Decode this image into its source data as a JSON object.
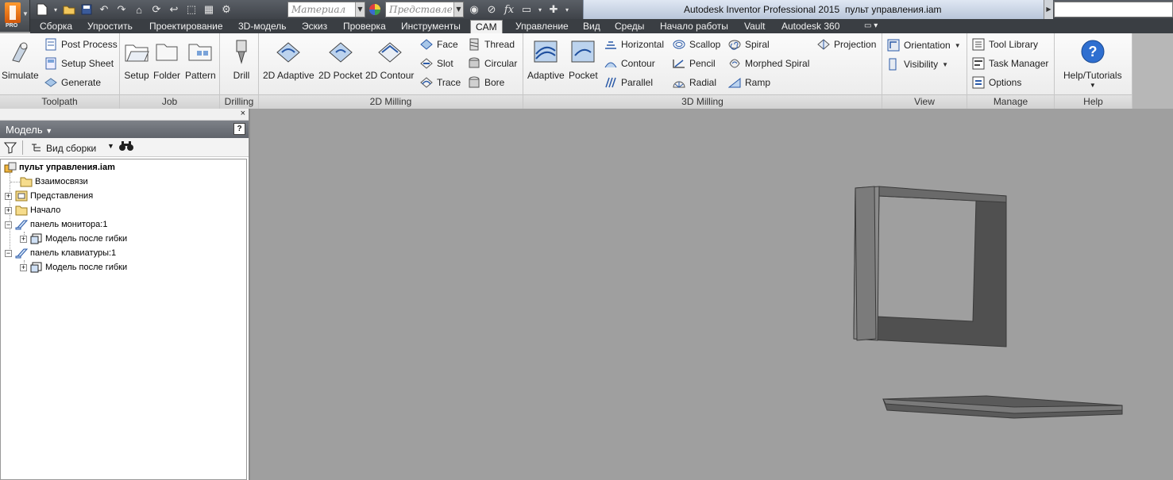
{
  "title_bar": {
    "app_name": "Autodesk Inventor Professional 2015",
    "document": "пульт управления.iam",
    "app_badge": "PRO",
    "material_placeholder": "Материал",
    "appearance_placeholder": "Представлен",
    "fx": "fx"
  },
  "menu_tabs": [
    "Сборка",
    "Упростить",
    "Проектирование",
    "3D-модель",
    "Эскиз",
    "Проверка",
    "Инструменты",
    "CAM",
    "Управление",
    "Вид",
    "Среды",
    "Начало работы",
    "Vault",
    "Autodesk 360"
  ],
  "active_tab": "CAM",
  "ribbon": {
    "toolpath": {
      "label": "Toolpath",
      "simulate": "Simulate",
      "post_process": "Post Process",
      "setup_sheet": "Setup Sheet",
      "generate": "Generate"
    },
    "job": {
      "label": "Job",
      "setup": "Setup",
      "folder": "Folder",
      "pattern": "Pattern"
    },
    "drilling": {
      "label": "Drilling",
      "drill": "Drill"
    },
    "milling2d": {
      "label": "2D Milling",
      "adaptive": "2D Adaptive",
      "pocket": "2D Pocket",
      "contour": "2D Contour",
      "face": "Face",
      "slot": "Slot",
      "trace": "Trace",
      "thread": "Thread",
      "circular": "Circular",
      "bore": "Bore"
    },
    "milling3d": {
      "label": "3D Milling",
      "adaptive": "Adaptive",
      "pocket": "Pocket",
      "horizontal": "Horizontal",
      "contour": "Contour",
      "parallel": "Parallel",
      "scallop": "Scallop",
      "pencil": "Pencil",
      "radial": "Radial",
      "spiral": "Spiral",
      "morphed_spiral": "Morphed Spiral",
      "ramp": "Ramp",
      "projection": "Projection"
    },
    "view": {
      "label": "View",
      "orientation": "Orientation",
      "visibility": "Visibility"
    },
    "manage": {
      "label": "Manage",
      "tool_library": "Tool Library",
      "task_manager": "Task Manager",
      "options": "Options"
    },
    "help": {
      "label": "Help",
      "tutorials": "Help/Tutorials"
    }
  },
  "browser": {
    "title": "Модель",
    "help_glyph": "?",
    "close_glyph": "×",
    "view_label": "Вид сборки",
    "tree": {
      "root": "пульт управления.iam",
      "relations": "Взаимосвязи",
      "representations": "Представления",
      "origin": "Начало",
      "monitor_panel": "панель  монитора:1",
      "model_after_bend_1": "Модель после гибки",
      "keyboard_panel": "панель клавиатуры:1",
      "model_after_bend_2": "Модель после гибки"
    }
  }
}
